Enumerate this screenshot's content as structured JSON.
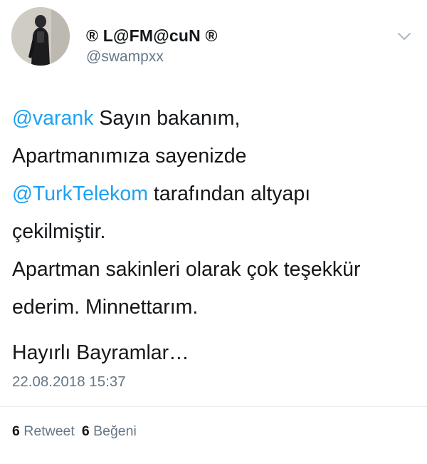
{
  "user": {
    "display_name": "® L@FM@cuN ®",
    "handle": "@swampxx"
  },
  "tweet": {
    "lines": [
      {
        "mention": "@varank",
        "text": " Sayın bakanım,"
      },
      {
        "text": "Apartmanımıza sayenizde"
      },
      {
        "mention": "@TurkTelekom",
        "text": " tarafından altyapı"
      },
      {
        "text": "çekilmiştir."
      },
      {
        "text": "Apartman sakinleri olarak çok teşekkür"
      },
      {
        "text": "ederim. Minnettarım."
      },
      {
        "text": "Hayırlı Bayramlar…"
      }
    ],
    "timestamp": "22.08.2018 15:37"
  },
  "stats": {
    "retweet_count": "6",
    "retweet_label": "Retweet",
    "like_count": "6",
    "like_label": "Beğeni"
  },
  "icons": {
    "menu": "chevron-down-icon"
  },
  "colors": {
    "link": "#1da1f2",
    "secondary_text": "#657786",
    "primary_text": "#14171a"
  }
}
